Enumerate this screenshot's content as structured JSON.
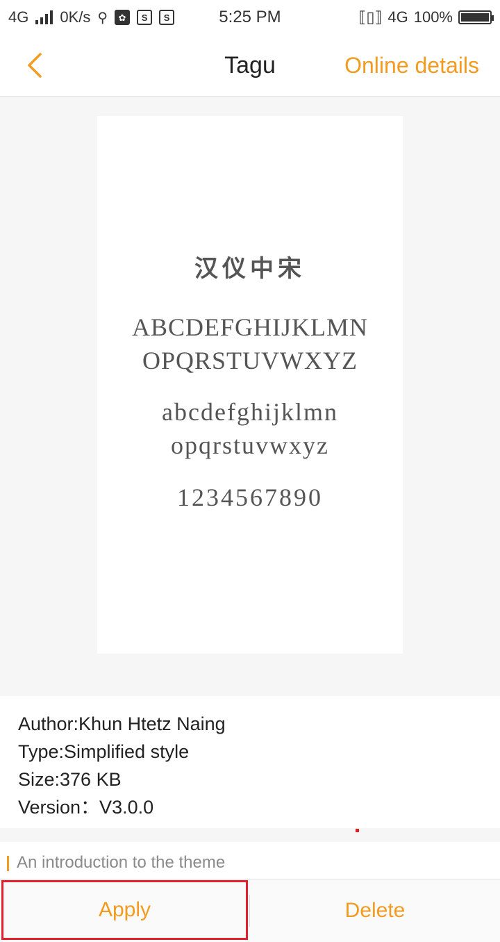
{
  "status_bar": {
    "network_left": "4G",
    "speed": "0K/s",
    "time": "5:25 PM",
    "network_right": "4G",
    "battery": "100%",
    "icons": [
      "signal-icon",
      "usb-icon",
      "tool-icon",
      "s-icon",
      "s-icon",
      "vibrate-icon",
      "data-arrows-icon",
      "battery-icon"
    ]
  },
  "nav": {
    "title": "Tagu",
    "action": "Online details",
    "back_icon": "chevron-left-icon",
    "accent_color": "#f39b21"
  },
  "preview": {
    "chinese": "汉仪中宋",
    "upper_line1": "ABCDEFGHIJKLMN",
    "upper_line2": "OPQRSTUVWXYZ",
    "lower_line1": "abcdefghijklmn",
    "lower_line2": "opqrstuvwxyz",
    "digits": "1234567890"
  },
  "info": {
    "author": "Author:Khun Htetz Naing",
    "type": "Type:Simplified style",
    "size": "Size:376 KB",
    "version": "Version：V3.0.0"
  },
  "intro": {
    "label": "An introduction to the theme"
  },
  "buttons": {
    "apply": "Apply",
    "delete": "Delete"
  }
}
